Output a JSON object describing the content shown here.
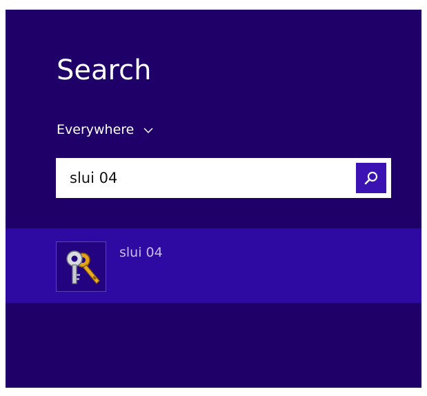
{
  "charm": {
    "title": "Search",
    "scope": {
      "label": "Everywhere",
      "icon": "chevron-down-icon"
    },
    "search": {
      "value": "slui 04",
      "button_icon": "search-icon"
    },
    "results": [
      {
        "label": "slui 04",
        "icon": "keys-icon"
      }
    ]
  },
  "colors": {
    "background": "#1f0068",
    "selected_row": "#2e0aa2",
    "search_button": "#3a13b2",
    "result_text": "#c8bdf0"
  }
}
